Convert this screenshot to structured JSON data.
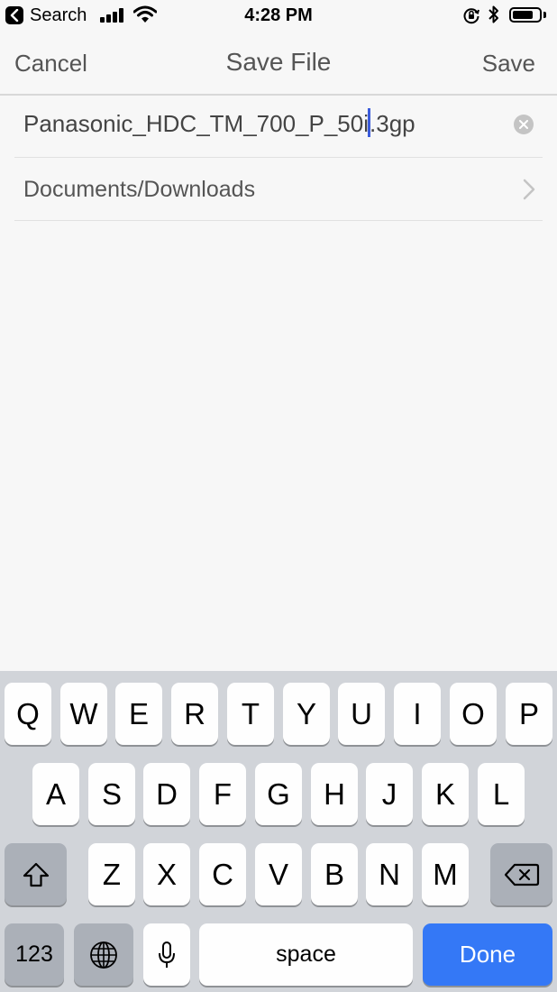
{
  "status_bar": {
    "back_app": "Search",
    "time": "4:28 PM",
    "battery_level": 0.8
  },
  "nav": {
    "cancel_label": "Cancel",
    "title": "Save File",
    "save_label": "Save"
  },
  "form": {
    "filename_before_cursor": "Panasonic_HDC_TM_700_P_50i",
    "filename_after_cursor": ".3gp",
    "folder_path": "Documents/Downloads"
  },
  "keyboard": {
    "row1": [
      "Q",
      "W",
      "E",
      "R",
      "T",
      "Y",
      "U",
      "I",
      "O",
      "P"
    ],
    "row2": [
      "A",
      "S",
      "D",
      "F",
      "G",
      "H",
      "J",
      "K",
      "L"
    ],
    "row3": [
      "Z",
      "X",
      "C",
      "V",
      "B",
      "N",
      "M"
    ],
    "numbers_label": "123",
    "space_label": "space",
    "done_label": "Done"
  },
  "colors": {
    "done_key": "#3478f6",
    "caret": "#3b5bdb"
  }
}
